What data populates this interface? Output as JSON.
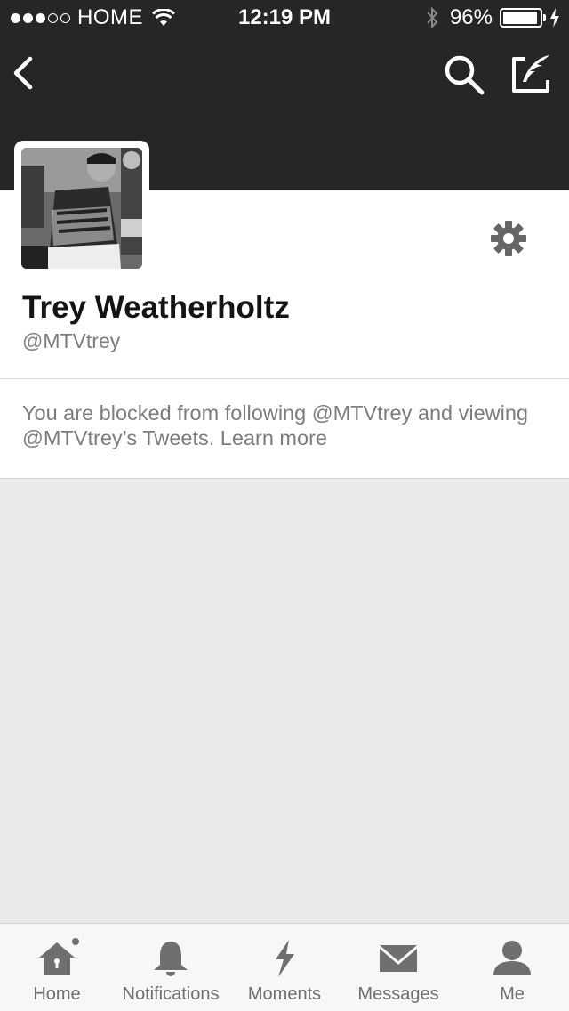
{
  "status_bar": {
    "carrier": "HOME",
    "time": "12:19 PM",
    "battery_percent": "96%",
    "battery_level": 0.96,
    "signal_bars": 3,
    "signal_max": 5
  },
  "nav": {
    "back_icon": "chevron-left-icon",
    "search_icon": "search-icon",
    "compose_icon": "compose-tweet-icon"
  },
  "profile": {
    "display_name": "Trey Weatherholtz",
    "handle": "@MTVtrey",
    "settings_icon": "gear-icon"
  },
  "blocked_notice": {
    "text": "You are blocked from following @MTVtrey and viewing @MTVtrey’s Tweets.",
    "link": "Learn more"
  },
  "tabbar": {
    "items": [
      {
        "label": "Home",
        "icon": "home-icon",
        "badge_dot": true
      },
      {
        "label": "Notifications",
        "icon": "bell-icon"
      },
      {
        "label": "Moments",
        "icon": "lightning-icon"
      },
      {
        "label": "Messages",
        "icon": "envelope-icon"
      },
      {
        "label": "Me",
        "icon": "person-icon"
      }
    ]
  },
  "colors": {
    "header_bg": "#262626",
    "page_bg": "#e9e9e9",
    "muted_text": "#7c7c7c",
    "icon_gray": "#6f6f6f"
  }
}
